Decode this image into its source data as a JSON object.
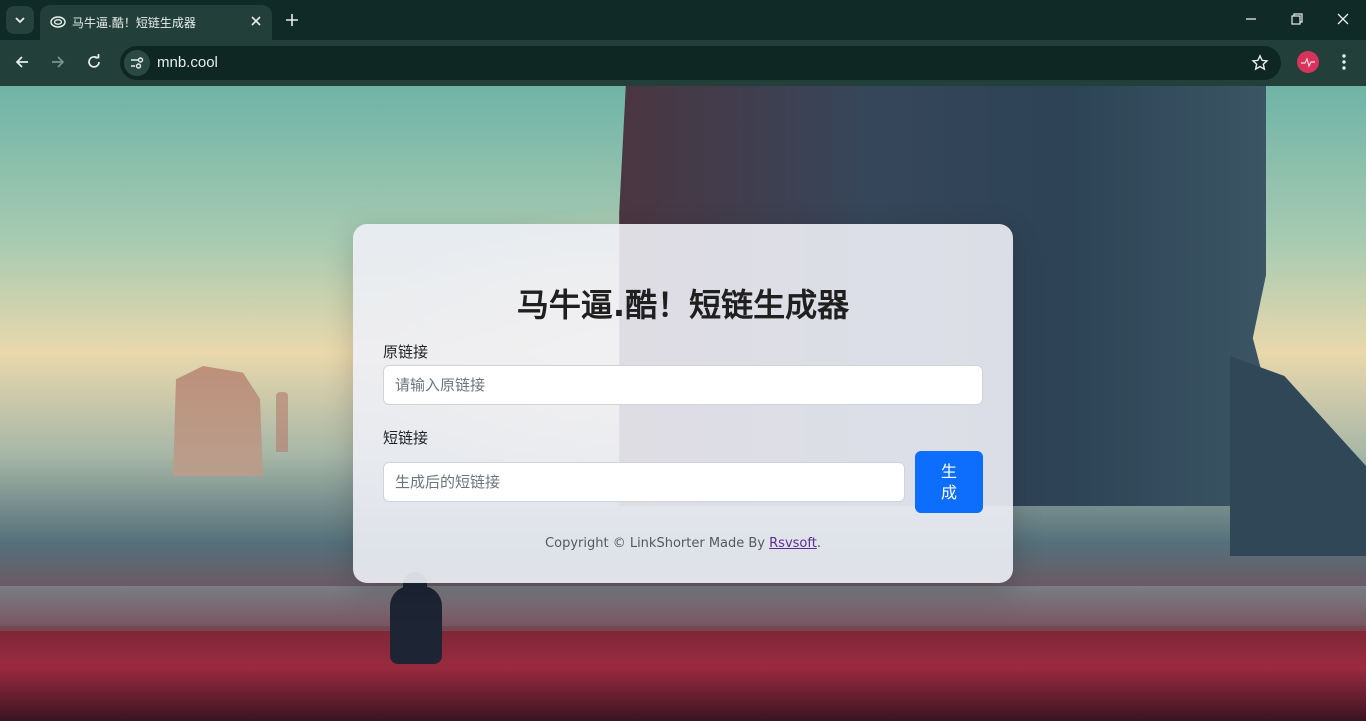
{
  "browser": {
    "tab_title": "马牛逼.酷！短链生成器",
    "url": "mnb.cool"
  },
  "page": {
    "title": "马牛逼.酷！短链生成器",
    "original_link": {
      "label": "原链接",
      "placeholder": "请输入原链接",
      "value": ""
    },
    "short_link": {
      "label": "短链接",
      "placeholder": "生成后的短链接",
      "value": ""
    },
    "generate_button": "生成",
    "footer": {
      "prefix": "Copyright © LinkShorter Made By ",
      "link_text": "Rsvsoft",
      "suffix": "."
    }
  },
  "colors": {
    "accent": "#0d6efd",
    "chrome_bg": "#102a27",
    "toolbar_bg": "#224039",
    "profile": "#d6345a"
  },
  "icons": [
    "tab-search-icon",
    "favicon-icon",
    "close-icon",
    "plus-icon",
    "minimize-icon",
    "restore-icon",
    "window-close-icon",
    "back-icon",
    "forward-icon",
    "reload-icon",
    "site-info-icon",
    "star-icon",
    "profile-icon",
    "menu-icon"
  ]
}
